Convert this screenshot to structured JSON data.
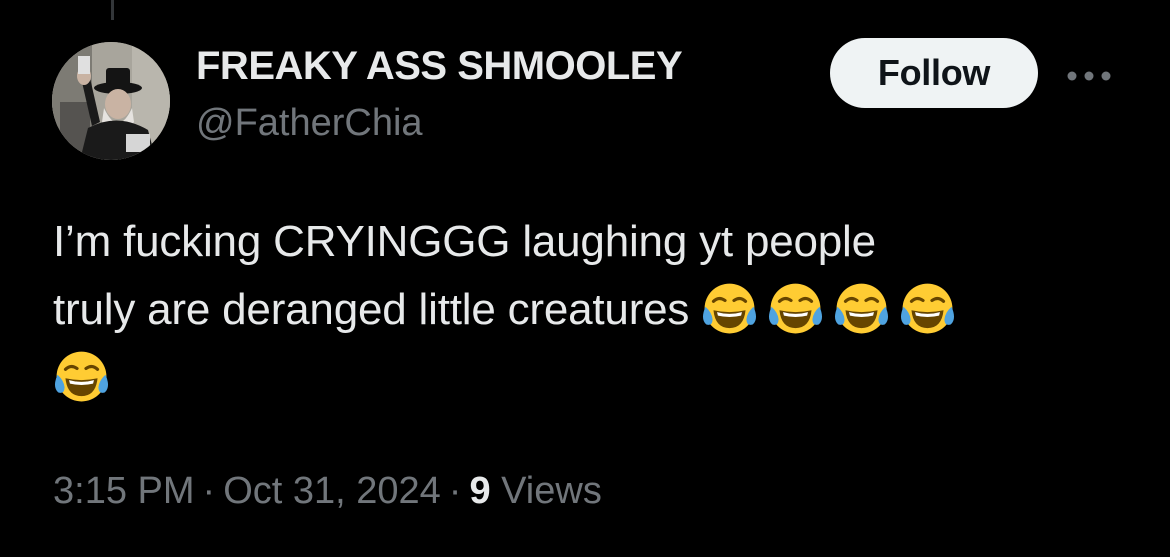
{
  "tweet": {
    "author": {
      "display_name": "FREAKY ASS SHMOOLEY",
      "handle": "@FatherChia",
      "avatar_icon": "profile-photo"
    },
    "follow_label": "Follow",
    "more_icon": "ellipsis-icon",
    "text_lines": [
      "I’m fucking CRYINGGG laughing yt people",
      "truly are deranged little creatures"
    ],
    "emoji": "face-with-tears-of-joy",
    "emoji_count": 5,
    "time": "3:15 PM",
    "separator": "·",
    "date": "Oct 31, 2024",
    "views_count": "9",
    "views_label": "Views"
  },
  "colors": {
    "background": "#000000",
    "primary_text": "#e7e9ea",
    "secondary_text": "#71767b",
    "follow_bg": "#eff3f4",
    "follow_text": "#0f1419"
  }
}
